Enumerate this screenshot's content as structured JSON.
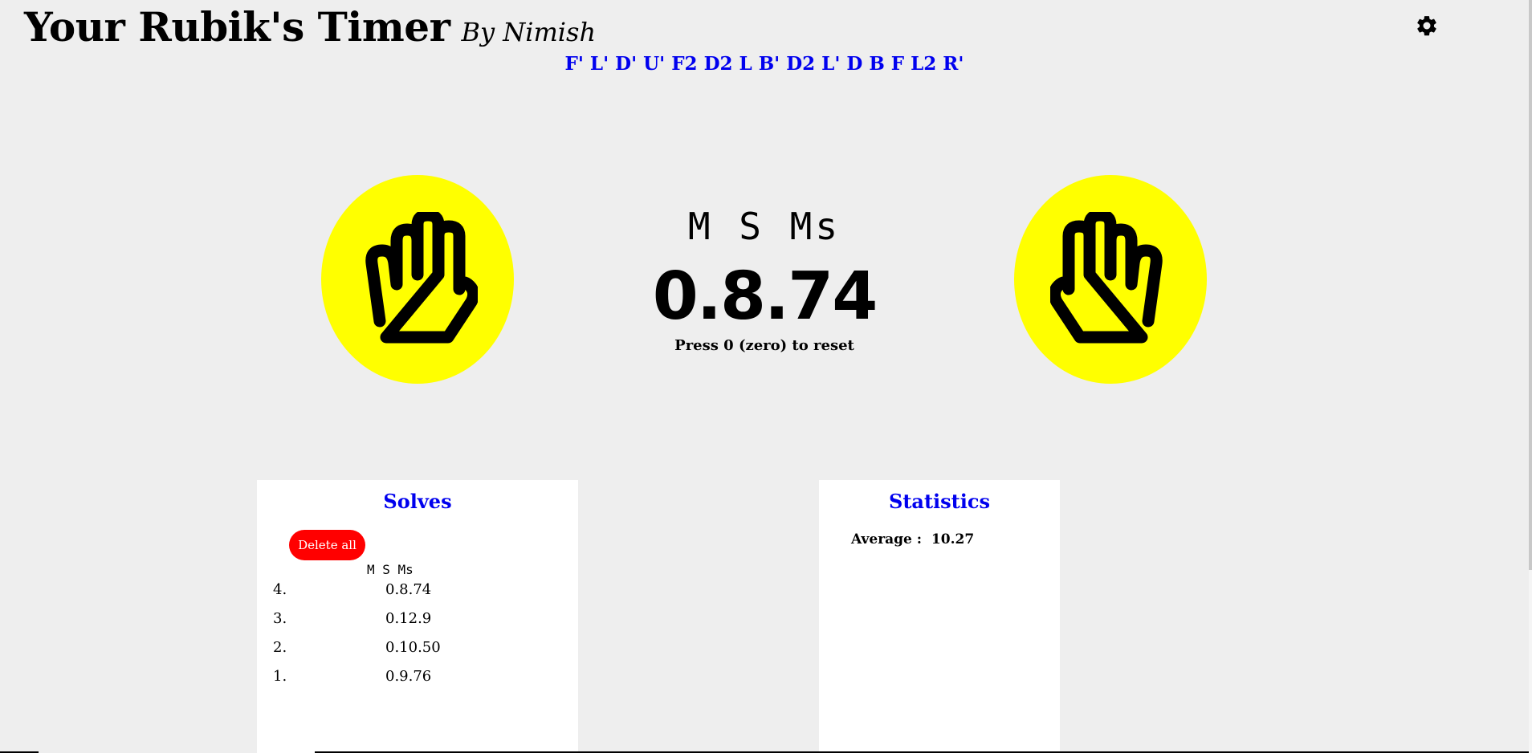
{
  "header": {
    "title": "Your Rubik's Timer",
    "byline": "By Nimish"
  },
  "scramble": "F' L' D' U' F2 D2 L B' D2 L' D B F L2 R'",
  "timer": {
    "units_label": "M S Ms",
    "value": "0.8.74",
    "reset_hint": "Press 0 (zero) to reset"
  },
  "hands": {
    "left_icon": "hand-icon",
    "right_icon": "hand-icon",
    "pad_color": "#ffff00"
  },
  "solves": {
    "title": "Solves",
    "delete_all_label": "Delete all",
    "column_header": "M S Ms",
    "items": [
      {
        "index": "4.",
        "time": "0.8.74"
      },
      {
        "index": "3.",
        "time": "0.12.9"
      },
      {
        "index": "2.",
        "time": "0.10.50"
      },
      {
        "index": "1.",
        "time": "0.9.76"
      }
    ]
  },
  "statistics": {
    "title": "Statistics",
    "average_label": "Average :",
    "average_value": "10.27"
  },
  "colors": {
    "accent": "#0000ee",
    "danger": "#ff0000",
    "background": "#eeeeee"
  }
}
